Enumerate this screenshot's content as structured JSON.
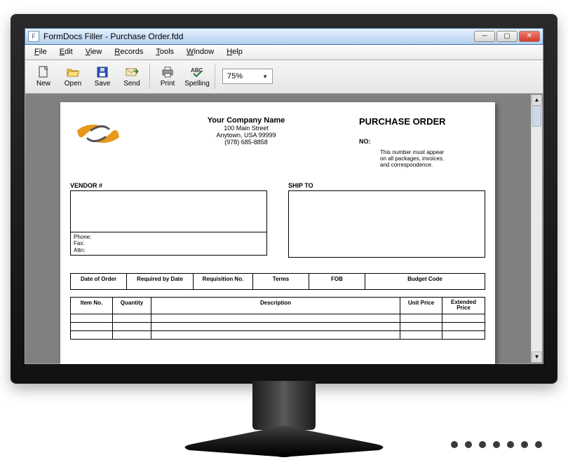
{
  "title": "FormDocs Filler - Purchase Order.fdd",
  "menu": {
    "file": "File",
    "edit": "Edit",
    "view": "View",
    "records": "Records",
    "tools": "Tools",
    "window": "Window",
    "help": "Help"
  },
  "toolbar": {
    "new": "New",
    "open": "Open",
    "save": "Save",
    "send": "Send",
    "print": "Print",
    "spelling": "Spelling"
  },
  "zoom": "75%",
  "doc": {
    "company": {
      "name": "Your Company Name",
      "street": "100 Main Street",
      "city": "Anytown, USA 99999",
      "phone": "(978) 685-8858"
    },
    "po_title": "PURCHASE ORDER",
    "no_label": "NO:",
    "note_l1": "This number must appear",
    "note_l2": "on all packages, invoices,",
    "note_l3": "and correspondence.",
    "vendor_label": "VENDOR #",
    "shipto_label": "SHIP TO",
    "phone_label": "Phone:",
    "fax_label": "Fax:",
    "attn_label": "Attn:",
    "cols": {
      "date": "Date of Order",
      "reqdate": "Required by Date",
      "reqno": "Requisition No.",
      "terms": "Terms",
      "fob": "FOB",
      "budget": "Budget Code",
      "itemno": "Item No.",
      "qty": "Quantity",
      "desc": "Description",
      "unit": "Unit Price",
      "ext_l1": "Extended",
      "ext_l2": "Price"
    }
  }
}
